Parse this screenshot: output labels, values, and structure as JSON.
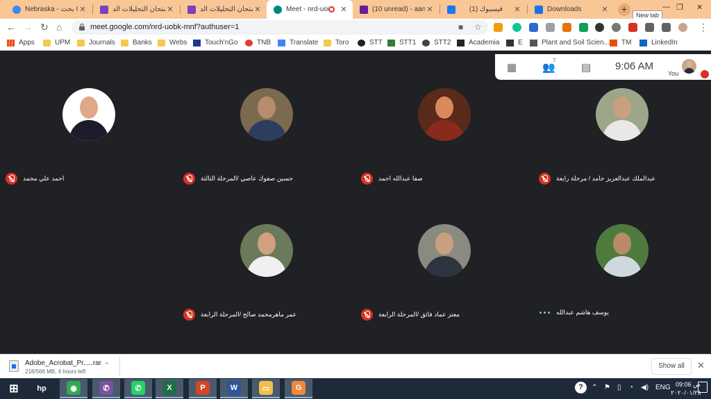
{
  "browser": {
    "tabs": [
      {
        "title": "Nebraska - بحث Go",
        "favicon_color": "#4285f4",
        "active": false
      },
      {
        "title": "امتحان التحليلات الد",
        "favicon_color": "#7b3fbf",
        "active": false
      },
      {
        "title": "امتحان التحليلات الد",
        "favicon_color": "#7b3fbf",
        "active": false
      },
      {
        "title": "Meet - nrd-uob",
        "favicon_color": "#00897b",
        "active": true
      },
      {
        "title": "(10 unread) - aama",
        "favicon_color": "#6a1b9a",
        "active": false
      },
      {
        "title": "(1) فيسبوك",
        "favicon_color": "#1877f2",
        "active": false
      },
      {
        "title": "Downloads",
        "favicon_color": "#1a73e8",
        "active": false
      }
    ],
    "new_tab_tooltip": "New tab",
    "url": "meet.google.com/nrd-uobk-mnf?authuser=1",
    "bookmarks": [
      {
        "label": "Apps",
        "icon": "apps-grid-icon"
      },
      {
        "label": "UPM",
        "icon": "folder-icon"
      },
      {
        "label": "Journals",
        "icon": "folder-icon"
      },
      {
        "label": "Banks",
        "icon": "folder-icon"
      },
      {
        "label": "Webs",
        "icon": "folder-icon"
      },
      {
        "label": "Touch'nGo",
        "icon": "touchngo-icon"
      },
      {
        "label": "TNB",
        "icon": "tnb-icon"
      },
      {
        "label": "Translate",
        "icon": "translate-icon"
      },
      {
        "label": "Toro",
        "icon": "folder-icon"
      },
      {
        "label": "STT",
        "icon": "stt-icon"
      },
      {
        "label": "STT1",
        "icon": "isa-icon"
      },
      {
        "label": "STT2",
        "icon": "globe-icon"
      },
      {
        "label": "Academia",
        "icon": "academia-icon"
      },
      {
        "label": "E",
        "icon": "h-icon"
      },
      {
        "label": "Plant and Soil Scien...",
        "icon": "plant-icon"
      },
      {
        "label": "TM",
        "icon": "tm-icon"
      },
      {
        "label": "LinkedIn",
        "icon": "linkedin-icon"
      }
    ]
  },
  "meet": {
    "clock": "9:06 AM",
    "people_count": "7",
    "self_label": "You",
    "participants": [
      {
        "name": "عبدالملك عبدالعزيز حامد / مرحلة رابعة",
        "mic": "off",
        "skin": "#c9a07f",
        "shirt": "#e8e8e8",
        "bg": "#9ea68a"
      },
      {
        "name": "صفا عبدالله احمد",
        "mic": "off",
        "skin": "#d98a5a",
        "shirt": "#8a2a1e",
        "bg": "#5a2a1a"
      },
      {
        "name": "حسين صفوك عاصي /المرحلة الثالثة",
        "mic": "off",
        "skin": "#b78c6c",
        "shirt": "#2c3e60",
        "bg": "#7a6a4e"
      },
      {
        "name": "احمد علي محمد",
        "mic": "off",
        "skin": "#e0a888",
        "shirt": "#1c1c2c",
        "bg": "#ffffff"
      },
      {
        "name": "يوسف هاشم عبدالله",
        "mic": "speaking",
        "skin": "#b88a66",
        "shirt": "#cfd8dc",
        "bg": "#4e7a3e"
      },
      {
        "name": "معتز عماد فائق /المرحلة الرابعة",
        "mic": "off",
        "skin": "#c8a080",
        "shirt": "#2e3440",
        "bg": "#8a8a80"
      },
      {
        "name": "عمر ماهرمحمد صالح /المرحلة الرابعة",
        "mic": "off",
        "skin": "#d0a080",
        "shirt": "#f0f0f0",
        "bg": "#6a7a5a"
      }
    ]
  },
  "download": {
    "file_name": "Adobe_Acrobat_Pr.....rar",
    "status": "218/566 MB, 4 hours left",
    "show_all": "Show all"
  },
  "taskbar": {
    "apps": [
      {
        "name": "start-icon",
        "color": "#1c2a3a",
        "label": "⊞"
      },
      {
        "name": "hp-icon",
        "color": "#1c2a3a",
        "label": "hp"
      },
      {
        "name": "chrome-icon",
        "color": "#34a853",
        "label": "◉"
      },
      {
        "name": "viber-icon",
        "color": "#7b519d",
        "label": "✆"
      },
      {
        "name": "whatsapp-icon",
        "color": "#25d366",
        "label": "✆"
      },
      {
        "name": "excel-icon",
        "color": "#1d6f42",
        "label": "X"
      },
      {
        "name": "powerpoint-icon",
        "color": "#d24726",
        "label": "P"
      },
      {
        "name": "word-icon",
        "color": "#2b579a",
        "label": "W"
      },
      {
        "name": "file-explorer-icon",
        "color": "#f2c04a",
        "label": "▭"
      },
      {
        "name": "pdf-reader-icon",
        "color": "#f0883a",
        "label": "G"
      }
    ],
    "language": "ENG",
    "time": "09:06 ص",
    "date": "٢٠٢٠/٠١/٢٨"
  }
}
